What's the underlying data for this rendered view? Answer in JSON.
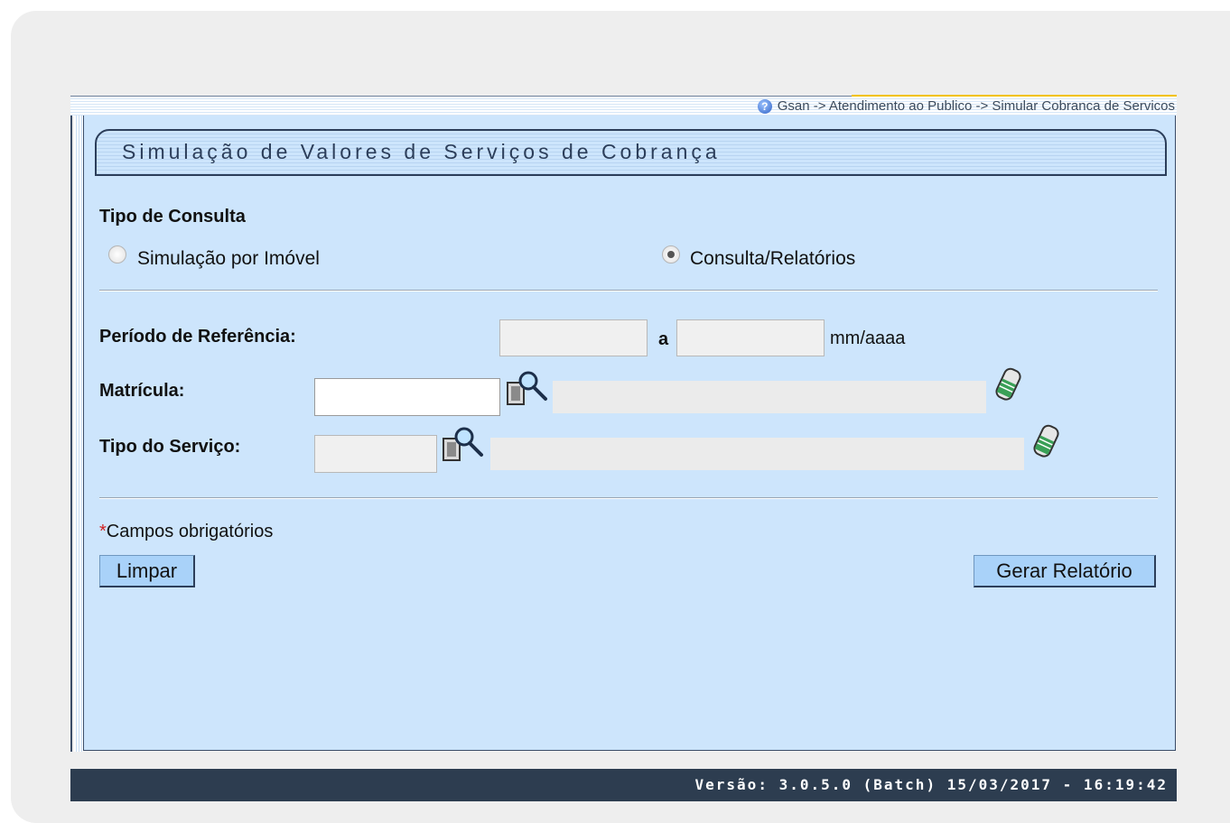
{
  "breadcrumb": {
    "text": "Gsan -> Atendimento ao Publico -> Simular Cobranca de Servicos"
  },
  "form": {
    "title": "Simulação de Valores de Serviços de Cobrança",
    "tipo_consulta_label": "Tipo de Consulta",
    "radio_simulacao_label": "Simulação por Imóvel",
    "radio_consulta_label": "Consulta/Relatórios",
    "selected_option": "Consulta/Relatórios",
    "periodo_label": "Período de Referência:",
    "periodo_sep": "a",
    "periodo_inicio_value": "",
    "periodo_fim_value": "",
    "periodo_format": "mm/aaaa",
    "matricula_label": "Matrícula:",
    "matricula_value": "",
    "matricula_desc": "",
    "tipo_servico_label": "Tipo do Serviço:",
    "tipo_servico_value": "",
    "tipo_servico_desc": "",
    "required_marker": "*",
    "required_note": "Campos obrigatórios",
    "clear_button": "Limpar",
    "report_button": "Gerar Relatório"
  },
  "footer": {
    "version": "Versão: 3.0.5.0 (Batch) 15/03/2017 - 16:19:42"
  },
  "colors": {
    "panel": "#cde5fc",
    "footer": "#2d3d50",
    "button": "#a9d2f9",
    "required": "#d02020"
  }
}
